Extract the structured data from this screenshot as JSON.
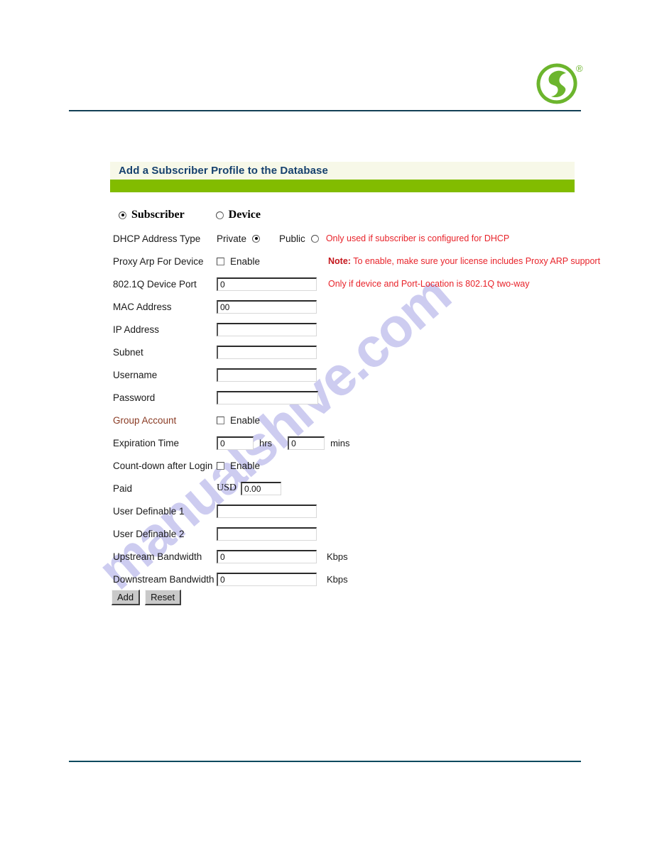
{
  "page": {
    "watermark": "manualshive.com",
    "accent_green": "#82bc00",
    "banner_bg": "#f7f8e8",
    "title_color": "#16416e",
    "note_color": "#e8232a",
    "rule_color": "#123f55"
  },
  "logo": {
    "name": "green-swirl-logo",
    "registered_mark": "®",
    "color": "#6cb52d"
  },
  "banner": {
    "title": "Add a Subscriber Profile to the Database"
  },
  "profile_type": {
    "options": [
      {
        "label": "Subscriber",
        "selected": true
      },
      {
        "label": "Device",
        "selected": false
      }
    ]
  },
  "fields": {
    "dhcp_address_type": {
      "label": "DHCP Address Type",
      "options": [
        {
          "label": "Private",
          "selected": true
        },
        {
          "label": "Public",
          "selected": false
        }
      ],
      "note": "Only used if subscriber is configured for DHCP"
    },
    "proxy_arp": {
      "label": "Proxy Arp For Device",
      "enable_label": "Enable",
      "checked": false,
      "note_prefix": "Note:",
      "note": " To enable, make sure your license includes Proxy ARP support"
    },
    "device_port": {
      "label": "802.1Q Device Port",
      "value": "0",
      "note": "Only if device and Port-Location is 802.1Q two-way"
    },
    "mac_address": {
      "label": "MAC Address",
      "value": "00"
    },
    "ip_address": {
      "label": "IP Address",
      "value": ""
    },
    "subnet": {
      "label": "Subnet",
      "value": ""
    },
    "username": {
      "label": "Username",
      "value": ""
    },
    "password": {
      "label": "Password",
      "value": ""
    },
    "group_account": {
      "label": "Group Account",
      "enable_label": "Enable",
      "checked": false
    },
    "expiration_time": {
      "label": "Expiration Time",
      "hours_value": "0",
      "hours_suffix": "hrs",
      "mins_value": "0",
      "mins_suffix": "mins"
    },
    "count_down": {
      "label": "Count-down after Login",
      "enable_label": "Enable",
      "checked": false
    },
    "paid": {
      "label": "Paid",
      "currency": "USD",
      "value": "0.00"
    },
    "user_definable_1": {
      "label": "User Definable 1",
      "value": ""
    },
    "user_definable_2": {
      "label": "User Definable 2",
      "value": ""
    },
    "upstream_bandwidth": {
      "label": "Upstream Bandwidth",
      "value": "0",
      "suffix": "Kbps"
    },
    "downstream_bandwidth": {
      "label": "Downstream Bandwidth",
      "value": "0",
      "suffix": "Kbps"
    }
  },
  "buttons": {
    "add": "Add",
    "reset": "Reset"
  }
}
